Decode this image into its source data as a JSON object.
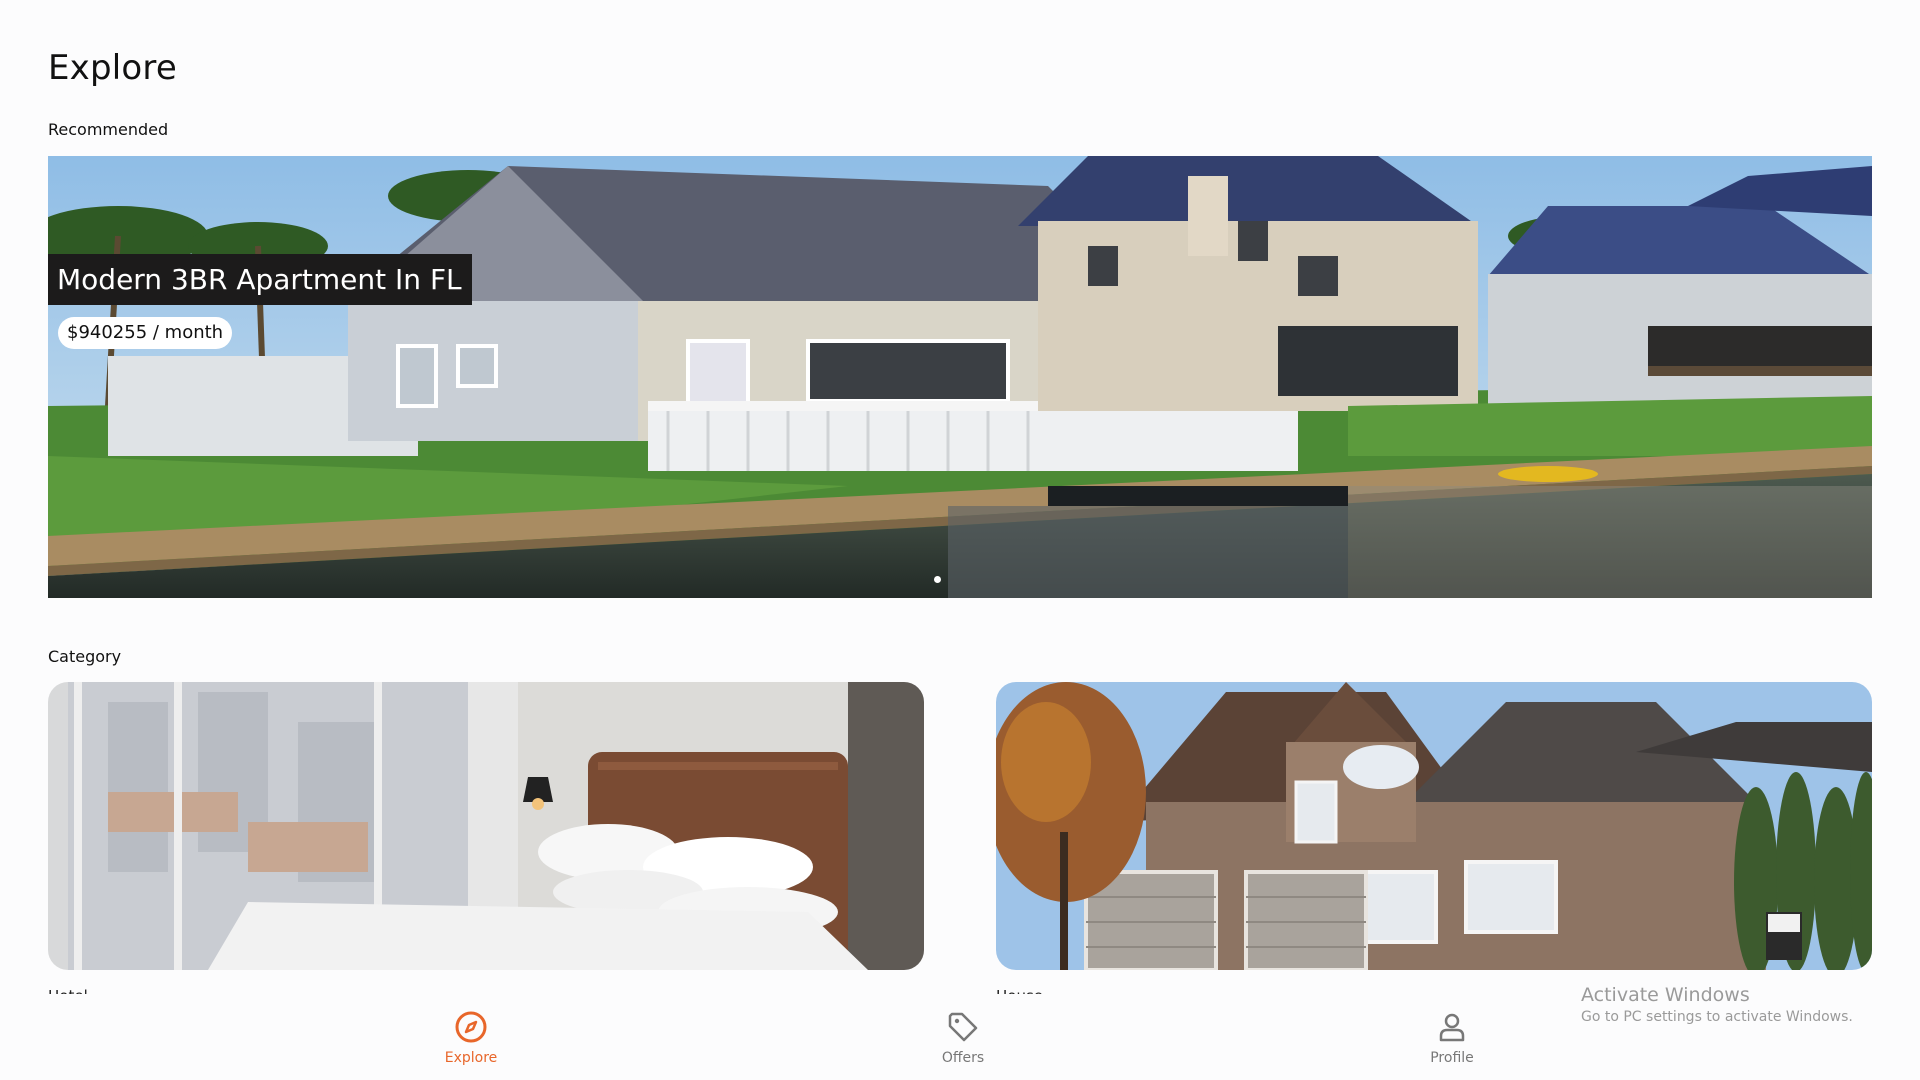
{
  "header": {
    "title": "Explore"
  },
  "recommended": {
    "label": "Recommended",
    "featured": {
      "title": "Modern 3BR Apartment In FL",
      "price": "$940255 / month"
    }
  },
  "category": {
    "label": "Category",
    "cards": [
      {
        "image": "bedroom-photo",
        "caption": "Hotel"
      },
      {
        "image": "brick-house-photo",
        "caption": "House"
      }
    ]
  },
  "bottom_nav": {
    "items": [
      {
        "label": "Explore",
        "icon": "compass-icon",
        "active": true
      },
      {
        "label": "Offers",
        "icon": "tag-icon",
        "active": false
      },
      {
        "label": "Profile",
        "icon": "user-icon",
        "active": false
      }
    ]
  },
  "watermark": {
    "line1": "Activate Windows",
    "line2": "Go to PC settings to activate Windows."
  },
  "colors": {
    "accent": "#e8662a",
    "inactive": "#777777",
    "badge_bg": "#1c1b1b"
  }
}
